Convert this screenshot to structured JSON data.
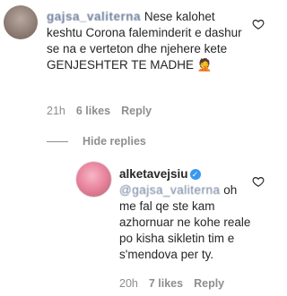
{
  "comment": {
    "username": "gajsa_valiterna",
    "text": "Nese kalohet keshtu Corona faleminderit e dashur se na e verteton dhe njehere kete GENJESHTER TE MADHE 🤦",
    "time": "21h",
    "likes": "6 likes",
    "reply_label": "Reply",
    "icon": "heart-outline-icon"
  },
  "replies_toggle": {
    "label": "Hide replies"
  },
  "reply": {
    "username": "alketavejsiu",
    "verified_icon": "verified-badge-icon",
    "mention": "@gajsa_valiterna",
    "text": "oh me fal qe ste kam azhornuar ne kohe reale po kisha sikletin tim e s'mendova per ty.",
    "time": "20h",
    "likes": "7 likes",
    "reply_label": "Reply",
    "icon": "heart-outline-icon"
  },
  "colors": {
    "link": "#00376b",
    "muted": "#8e8e8e",
    "verified": "#3897f0"
  }
}
